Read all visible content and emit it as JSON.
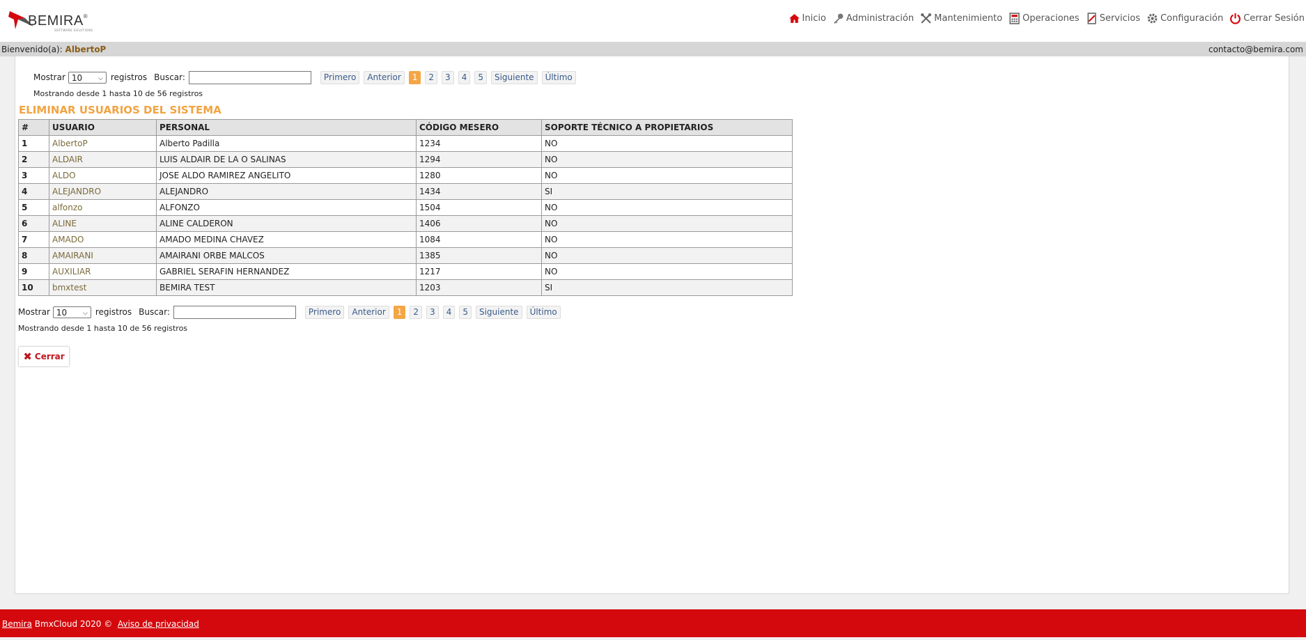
{
  "brand": {
    "name": "BEMIRA",
    "tagline": "SOFTWARE SOLUTIONS",
    "accent": "#d4090d"
  },
  "nav": [
    {
      "label": "Inicio",
      "icon": "home-icon"
    },
    {
      "label": "Administración",
      "icon": "key-icon"
    },
    {
      "label": "Mantenimiento",
      "icon": "tools-icon"
    },
    {
      "label": "Operaciones",
      "icon": "calculator-icon"
    },
    {
      "label": "Servicios",
      "icon": "services-icon"
    },
    {
      "label": "Configuración",
      "icon": "gear-icon"
    },
    {
      "label": "Cerrar Sesión",
      "icon": "power-icon"
    }
  ],
  "welcome": {
    "label": "Bienvenido(a):",
    "user": "AlbertoP",
    "contact": "contacto@bemira.com"
  },
  "controls": {
    "show_label": "Mostrar",
    "show_value": "10",
    "records_label": "registros",
    "search_label": "Buscar:",
    "search_value": "",
    "pager": {
      "first": "Primero",
      "prev": "Anterior",
      "pages": [
        "1",
        "2",
        "3",
        "4",
        "5"
      ],
      "current": "1",
      "next": "Siguiente",
      "last": "Último"
    },
    "info": "Mostrando desde 1 hasta 10 de 56 registros"
  },
  "title": "ELIMINAR USUARIOS DEL SISTEMA",
  "table": {
    "headers": [
      "#",
      "USUARIO",
      "PERSONAL",
      "CÓDIGO MESERO",
      "SOPORTE TÉCNICO A PROPIETARIOS"
    ],
    "rows": [
      [
        "1",
        "AlbertoP",
        "Alberto Padilla",
        "1234",
        "NO"
      ],
      [
        "2",
        "ALDAIR",
        "LUIS ALDAIR DE LA O SALINAS",
        "1294",
        "NO"
      ],
      [
        "3",
        "ALDO",
        "JOSE ALDO RAMIREZ ANGELITO",
        "1280",
        "NO"
      ],
      [
        "4",
        "ALEJANDRO",
        "ALEJANDRO",
        "1434",
        "SI"
      ],
      [
        "5",
        "alfonzo",
        "ALFONZO",
        "1504",
        "NO"
      ],
      [
        "6",
        "ALINE",
        "ALINE CALDERON",
        "1406",
        "NO"
      ],
      [
        "7",
        "AMADO",
        "AMADO MEDINA CHAVEZ",
        "1084",
        "NO"
      ],
      [
        "8",
        "AMAIRANI",
        "AMAIRANI ORBE MALCOS",
        "1385",
        "NO"
      ],
      [
        "9",
        "AUXILIAR",
        "GABRIEL SERAFIN HERNANDEZ",
        "1217",
        "NO"
      ],
      [
        "10",
        "bmxtest",
        "BEMIRA TEST",
        "1203",
        "SI"
      ]
    ]
  },
  "close_button": "Cerrar",
  "footer": {
    "brand_link": "Bemira",
    "text": "BmxCloud 2020 ©",
    "privacy_link": "Aviso de privacidad"
  }
}
